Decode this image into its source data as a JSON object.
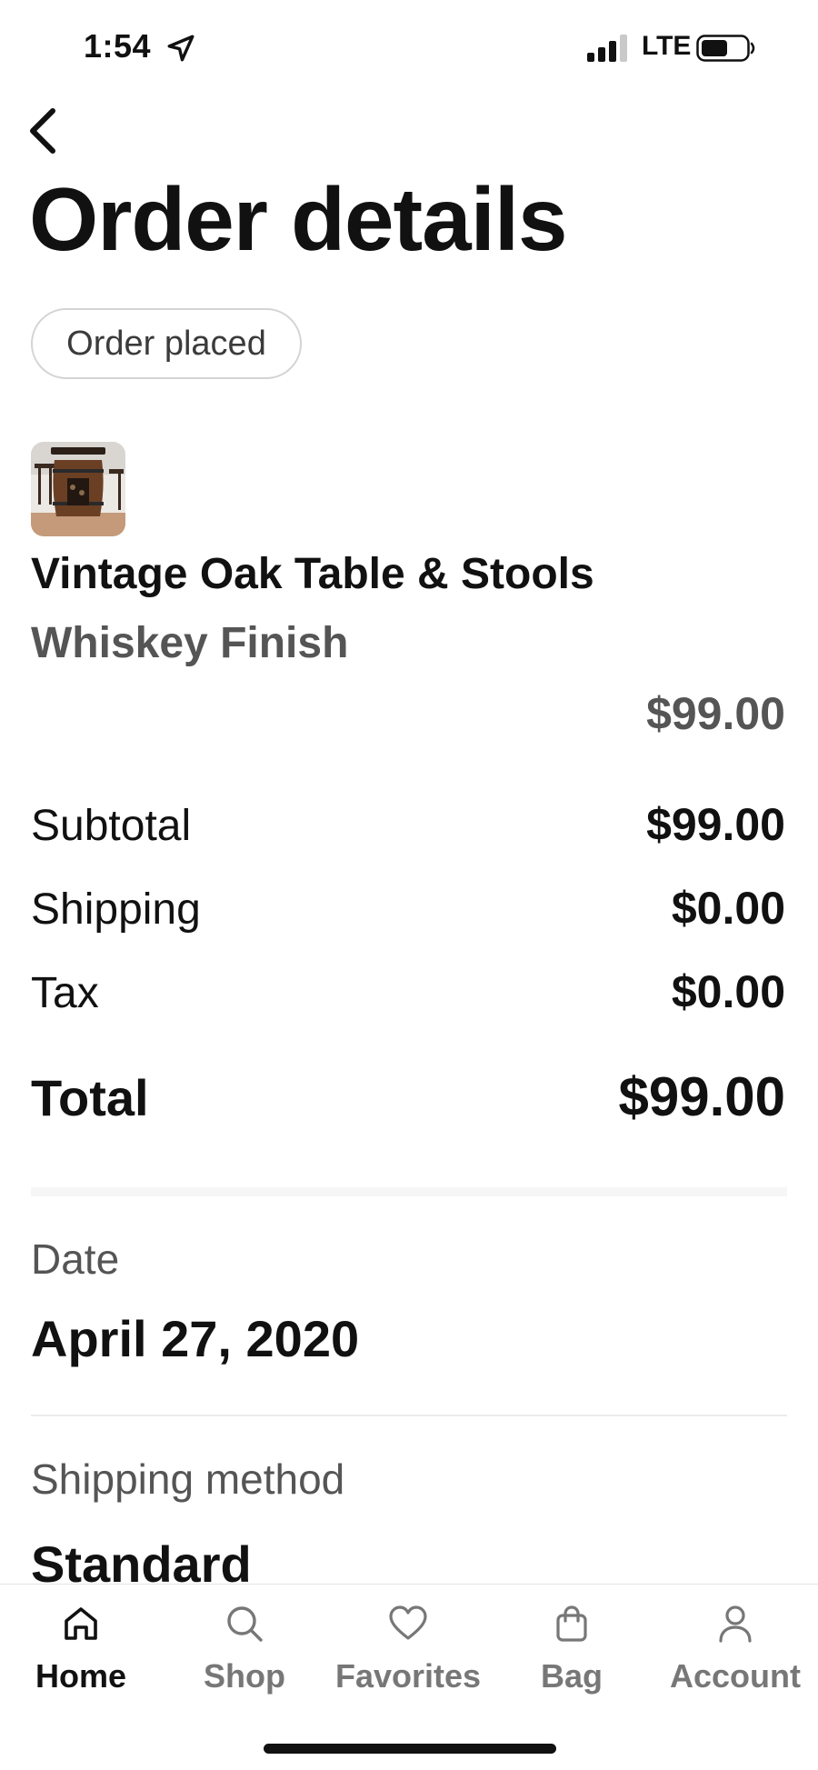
{
  "status_bar": {
    "time": "1:54",
    "network": "LTE"
  },
  "header": {
    "title": "Order details"
  },
  "order": {
    "status": "Order placed"
  },
  "item": {
    "name": "Vintage Oak Table & Stools",
    "variant": "Whiskey Finish",
    "price": "$99.00",
    "thumbnail_icon": "barrel-table-photo"
  },
  "summary": {
    "rows": [
      {
        "label": "Subtotal",
        "value": "$99.00"
      },
      {
        "label": "Shipping",
        "value": "$0.00"
      },
      {
        "label": "Tax",
        "value": "$0.00"
      }
    ],
    "total": {
      "label": "Total",
      "value": "$99.00"
    }
  },
  "details": {
    "date_label": "Date",
    "date_value": "April 27, 2020",
    "shipping_label": "Shipping method",
    "shipping_value": "Standard"
  },
  "tab_bar": {
    "tabs": [
      {
        "label": "Home",
        "icon": "home-icon",
        "active": true
      },
      {
        "label": "Shop",
        "icon": "search-icon",
        "active": false
      },
      {
        "label": "Favorites",
        "icon": "heart-icon",
        "active": false
      },
      {
        "label": "Bag",
        "icon": "bag-icon",
        "active": false
      },
      {
        "label": "Account",
        "icon": "person-icon",
        "active": false
      }
    ]
  },
  "colors": {
    "primary_text": "#111111",
    "secondary_text": "#555555",
    "inactive_tab": "#777777",
    "divider": "#ececec",
    "pill_border": "#d4d4d4"
  }
}
